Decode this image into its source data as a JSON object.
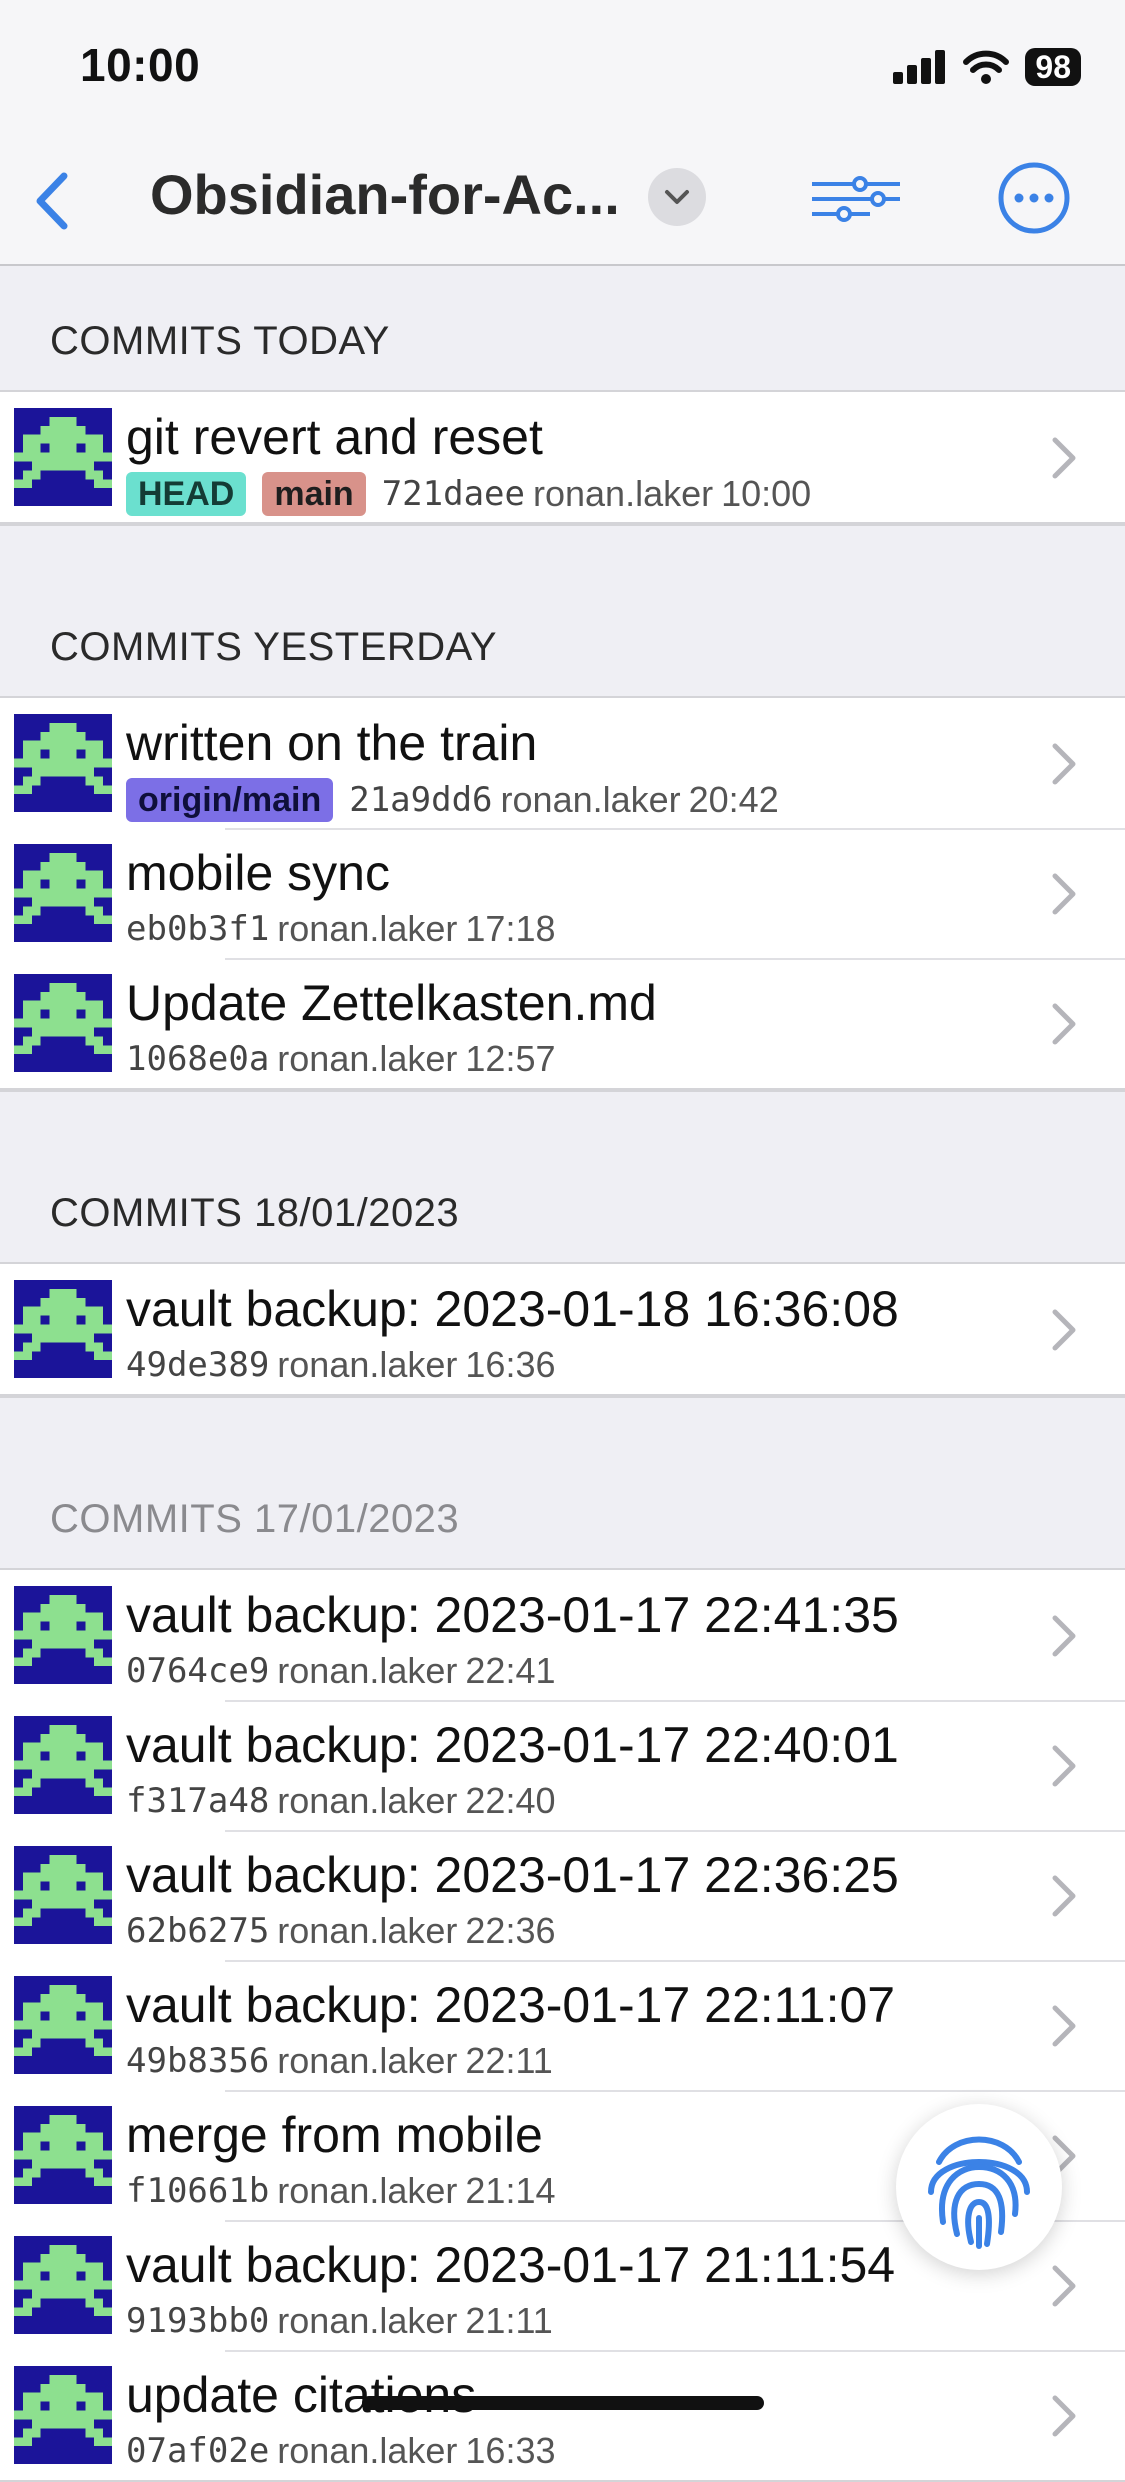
{
  "status_bar": {
    "time": "10:00",
    "battery": "98"
  },
  "nav": {
    "title": "Obsidian-for-Ac...",
    "colors": {
      "accent": "#3b82e6"
    }
  },
  "sections": [
    {
      "title": "COMMITS TODAY",
      "commits": [
        {
          "message": "git revert and reset",
          "badges": [
            {
              "label": "HEAD",
              "kind": "head"
            },
            {
              "label": "main",
              "kind": "main"
            }
          ],
          "hash": "721daee",
          "author": "ronan.laker",
          "time": "10:00"
        }
      ]
    },
    {
      "title": "COMMITS YESTERDAY",
      "commits": [
        {
          "message": "written on the train",
          "badges": [
            {
              "label": "origin/main",
              "kind": "origin"
            }
          ],
          "hash": "21a9dd6",
          "author": "ronan.laker",
          "time": "20:42"
        },
        {
          "message": "mobile sync",
          "badges": [],
          "hash": "eb0b3f1",
          "author": "ronan.laker",
          "time": "17:18"
        },
        {
          "message": "Update Zettelkasten.md",
          "badges": [],
          "hash": "1068e0a",
          "author": "ronan.laker",
          "time": "12:57"
        }
      ]
    },
    {
      "title": "COMMITS 18/01/2023",
      "commits": [
        {
          "message": "vault backup: 2023-01-18 16:36:08",
          "badges": [],
          "hash": "49de389",
          "author": "ronan.laker",
          "time": "16:36"
        }
      ]
    },
    {
      "title": "COMMITS 17/01/2023",
      "dim": true,
      "commits": [
        {
          "message": "vault backup: 2023-01-17 22:41:35",
          "badges": [],
          "hash": "0764ce9",
          "author": "ronan.laker",
          "time": "22:41"
        },
        {
          "message": "vault backup: 2023-01-17 22:40:01",
          "badges": [],
          "hash": "f317a48",
          "author": "ronan.laker",
          "time": "22:40"
        },
        {
          "message": "vault backup: 2023-01-17 22:36:25",
          "badges": [],
          "hash": "62b6275",
          "author": "ronan.laker",
          "time": "22:36"
        },
        {
          "message": "vault backup: 2023-01-17 22:11:07",
          "badges": [],
          "hash": "49b8356",
          "author": "ronan.laker",
          "time": "22:11"
        },
        {
          "message": "merge from mobile",
          "badges": [],
          "hash": "f10661b",
          "author": "ronan.laker",
          "time": "21:14"
        },
        {
          "message": "vault backup: 2023-01-17 21:11:54",
          "badges": [],
          "hash": "9193bb0",
          "author": "ronan.laker",
          "time": "21:11"
        },
        {
          "message": "update citations",
          "badges": [],
          "hash": "07af02e",
          "author": "ronan.laker",
          "time": "16:33"
        }
      ]
    }
  ],
  "icons": {
    "avatar": "space-invader-avatar-icon",
    "chevron": "chevron-right-icon",
    "fingerprint": "fingerprint-icon"
  }
}
